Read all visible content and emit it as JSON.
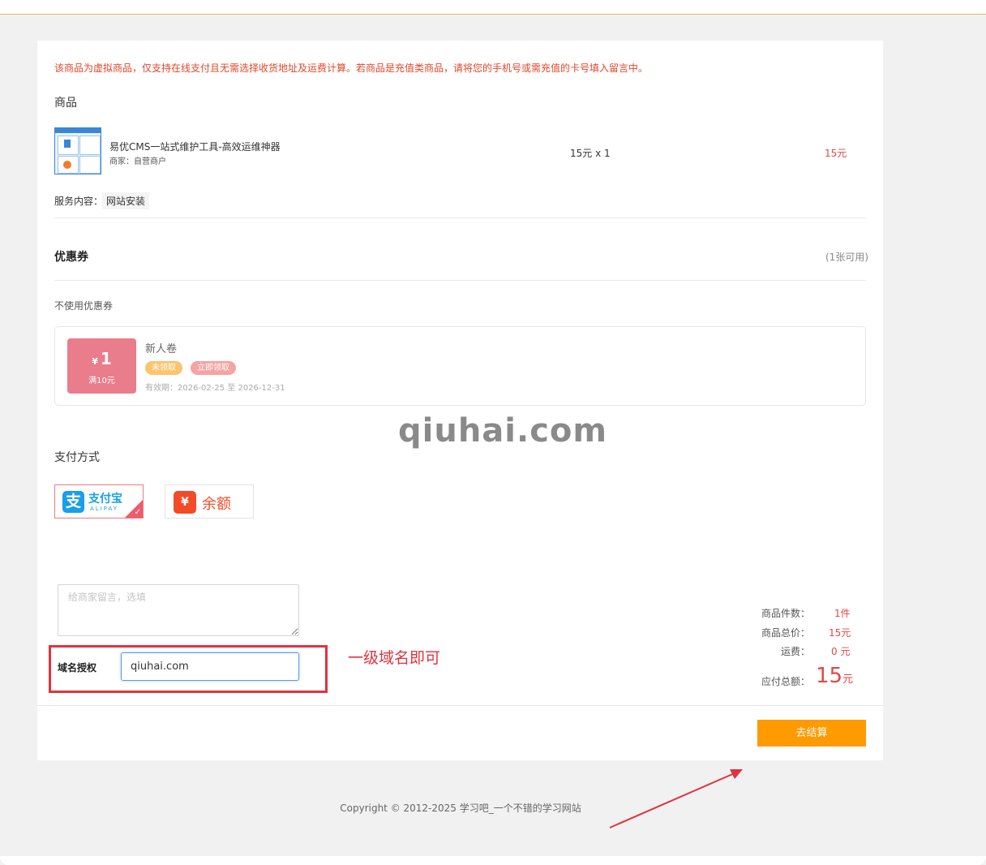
{
  "notice": "该商品为虚拟商品，仅支持在线支付且无需选择收货地址及运费计算。若商品是充值类商品，请将您的手机号或需充值的卡号填入留言中。",
  "goods_section": {
    "title": "商品",
    "product": {
      "name": "易优CMS一站式维护工具-高效运维神器",
      "seller": "商家：自营商户",
      "price_qty": "15元 x 1",
      "subtotal": "15元",
      "thumb_icon": "product-thumbnail"
    },
    "service_label": "服务内容：",
    "service_value": "网站安装"
  },
  "coupon_section": {
    "title": "优惠券",
    "available": "(1张可用)",
    "none_option": "不使用优惠券",
    "coupon": {
      "currency": "¥",
      "amount": "1",
      "condition": "满10元",
      "name": "新人卷",
      "status_badge": "未领取",
      "action_badge": "立即领取",
      "validity": "有效期：2026-02-25 至 2026-12-31"
    }
  },
  "watermark": "qiuhai.com",
  "payment_section": {
    "title": "支付方式",
    "options": [
      {
        "name": "支付宝",
        "sub": "ALIPAY",
        "icon": "alipay-icon",
        "icon_glyph": "支",
        "selected": true
      },
      {
        "name": "余额",
        "icon": "wallet-icon",
        "icon_glyph": "¥",
        "selected": false
      }
    ]
  },
  "message": {
    "placeholder": "给商家留言，选填",
    "value": ""
  },
  "domain": {
    "label": "域名授权",
    "value": "qiuhai.com",
    "annotation": "一级域名即可"
  },
  "summary": {
    "items_label": "商品件数：",
    "items_value": "1件",
    "total_label": "商品总价：",
    "total_value": "15元",
    "shipping_label": "运费：",
    "shipping_value": "0 元",
    "payable_label": "应付总额：",
    "payable_amount": "15",
    "payable_unit": "元"
  },
  "checkout_label": "去结算",
  "footer": "Copyright © 2012-2025 学习吧_一个不错的学习网站",
  "colors": {
    "accent": "#ff9a00",
    "price_red": "#e14848",
    "notice_red": "#e2462b",
    "coupon_pink": "#ea7d8b",
    "alipay_blue": "#1a9ee8",
    "wallet_orange": "#f24b27",
    "annotation_red": "#e0333d"
  }
}
